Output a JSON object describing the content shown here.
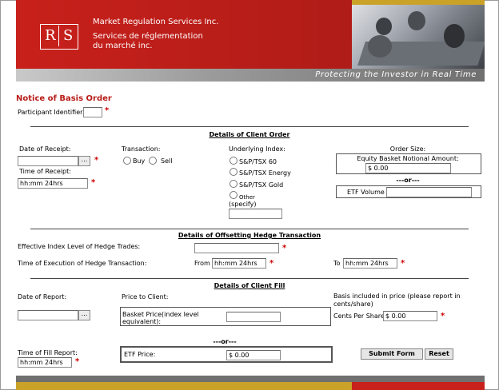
{
  "header": {
    "logo_r": "R",
    "logo_s": "S",
    "org_en": "Market Regulation Services Inc.",
    "org_fr": "Services de réglementation du marché inc.",
    "tagline": "Protecting the Investor in Real Time"
  },
  "form": {
    "title": "Notice of Basis Order",
    "participant_label": "Participant Identifier:",
    "participant_value": "",
    "client_order": {
      "heading": "Details of Client Order",
      "date_receipt_label": "Date of Receipt:",
      "date_receipt_value": "",
      "time_receipt_label": "Time of Receipt:",
      "time_receipt_value": "hh:mm 24hrs",
      "transaction_label": "Transaction:",
      "buy_label": "Buy",
      "sell_label": "Sell",
      "underlying_label": "Underlying Index:",
      "index_options": [
        "S&P/TSX 60",
        "S&P/TSX Energy",
        "S&P/TSX Gold",
        "Other"
      ],
      "specify_label": "(specify)",
      "specify_value": "",
      "order_size_label": "Order Size:",
      "equity_label": "Equity Basket Notional Amount:",
      "equity_value": "$ 0.00",
      "or_label": "---or---",
      "etf_volume_label": "ETF Volume",
      "etf_volume_value": ""
    },
    "hedge": {
      "heading": "Details of Offsetting Hedge Transaction",
      "effective_label": "Effective Index Level of Hedge Trades:",
      "effective_value": "",
      "time_exec_label": "Time of Execution of Hedge Transaction:",
      "from_label": "From",
      "from_value": "hh:mm 24hrs",
      "to_label": "To",
      "to_value": "hh:mm 24hrs"
    },
    "fill": {
      "heading": "Details of Client Fill",
      "date_report_label": "Date of Report:",
      "date_report_value": "",
      "price_label": "Price to Client:",
      "basis_label": "Basis included in price (please report in cents/share)",
      "basket_label": "Basket Price(index level equivalent):",
      "basket_value": "",
      "cents_label": "Cents Per Share",
      "cents_value": "$ 0.00",
      "or_label": "---or---",
      "etf_price_label": "ETF Price:",
      "etf_price_value": "$ 0.00",
      "time_fill_label": "Time of Fill Report:",
      "time_fill_value": "hh:mm 24hrs",
      "submit_label": "Submit Form",
      "reset_label": "Reset"
    },
    "calendar_button": "...",
    "required_mark": "*"
  },
  "colors": {
    "brand_red": "#c8201b",
    "gold": "#c9a227",
    "title_red": "#b81d18"
  }
}
